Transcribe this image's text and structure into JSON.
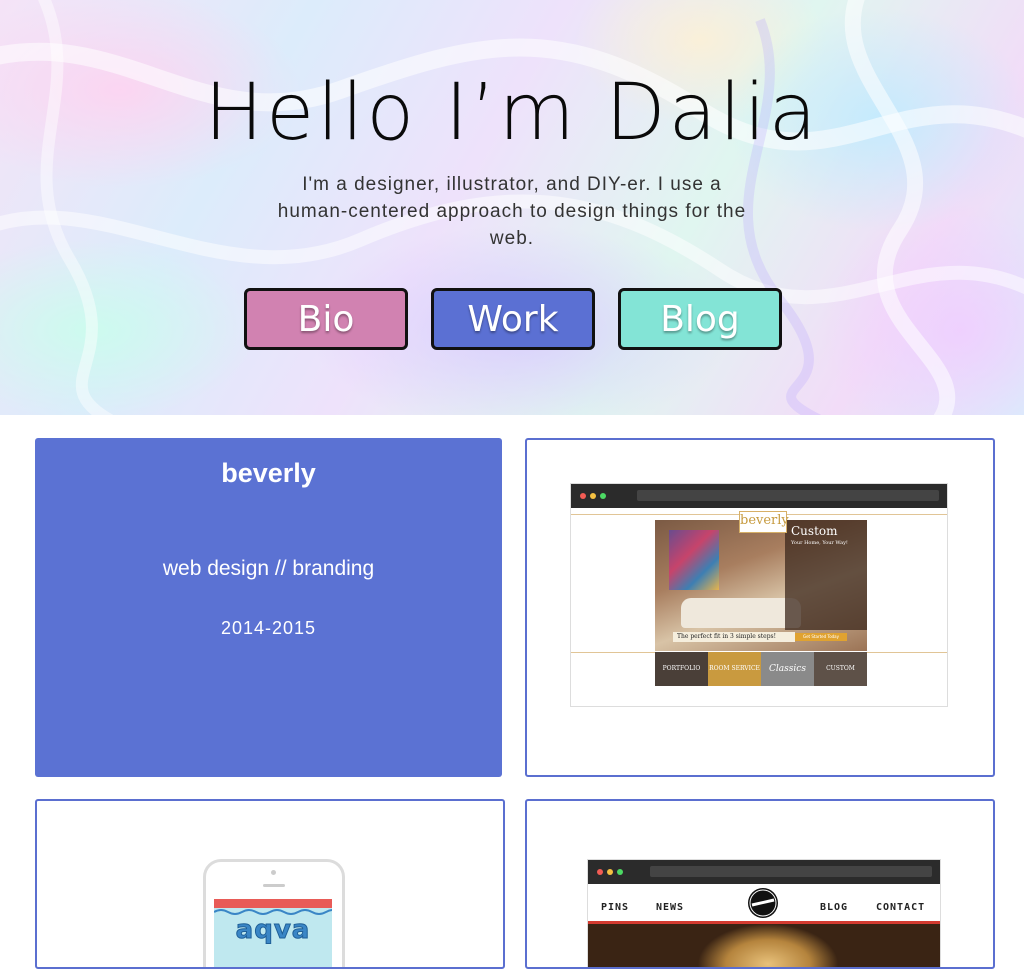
{
  "hero": {
    "title": "Hello I’m Dalia",
    "intro": "I'm a designer, illustrator, and DIY-er. I use a human-centered approach to design things for the web."
  },
  "nav": {
    "bio": "Bio",
    "work": "Work",
    "blog": "Blog"
  },
  "colors": {
    "bio": "#d182b1",
    "work": "#5b70d3",
    "blog": "#83e4d6",
    "card_blue": "#5b72d3"
  },
  "projects": [
    {
      "name": "beverly",
      "tags": "web design // branding",
      "years": "2014-2015",
      "preview": {
        "logo": "beverly",
        "heading": "Custom",
        "subheading": "Your Home, Your Way!",
        "strip": "The perfect fit in 3 simple steps!",
        "cta": "Get Started Today",
        "tiles": [
          "PORTFOLIO",
          "ROOM SERVICE",
          "Classics",
          "CUSTOM"
        ]
      }
    },
    {
      "preview": {
        "logo": "aqva"
      }
    },
    {
      "preview": {
        "nav": [
          "PINS",
          "NEWS",
          "BLOG",
          "CONTACT"
        ]
      }
    }
  ]
}
